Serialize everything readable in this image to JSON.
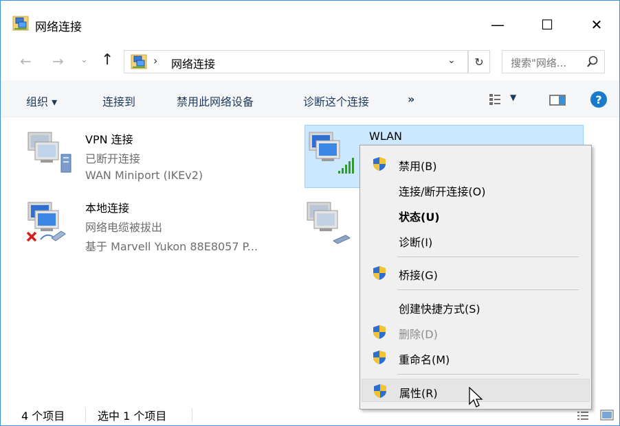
{
  "window": {
    "title": "网络连接",
    "min_glyph": "—",
    "max_glyph": "☐",
    "close_glyph": "✕"
  },
  "nav": {
    "back": "←",
    "forward": "→",
    "recent": "⌄",
    "up": "↑"
  },
  "address": {
    "separator": "›",
    "path": "网络连接",
    "dropdown": "⌄",
    "refresh": "↻"
  },
  "search": {
    "placeholder": "搜索\"网络..."
  },
  "commandbar": {
    "organize": "组织 ▾",
    "connect": "连接到",
    "disable": "禁用此网络设备",
    "diagnose": "诊断这个连接",
    "more": "»",
    "view_dropdown": "▼",
    "help": "?"
  },
  "items": {
    "vpn": {
      "name": "VPN 连接",
      "status": "已断开连接",
      "device": "WAN Miniport (IKEv2)"
    },
    "local": {
      "name": "本地连接",
      "status": "网络电缆被拔出",
      "device": "基于 Marvell Yukon 88E8057 P..."
    },
    "wlan": {
      "name": "WLAN"
    }
  },
  "context_menu": {
    "disable": "禁用(B)",
    "connect": "连接/断开连接(O)",
    "status": "状态(U)",
    "diagnose": "诊断(I)",
    "bridge": "桥接(G)",
    "shortcut": "创建快捷方式(S)",
    "delete": "删除(D)",
    "rename": "重命名(M)",
    "properties": "属性(R)"
  },
  "statusbar": {
    "count": "4 个项目",
    "selected": "选中 1 个项目"
  },
  "colors": {
    "accent": "#3e8ede",
    "selection": "#cce8ff",
    "command_text": "#1e395b",
    "help_blue": "#1979ca"
  }
}
